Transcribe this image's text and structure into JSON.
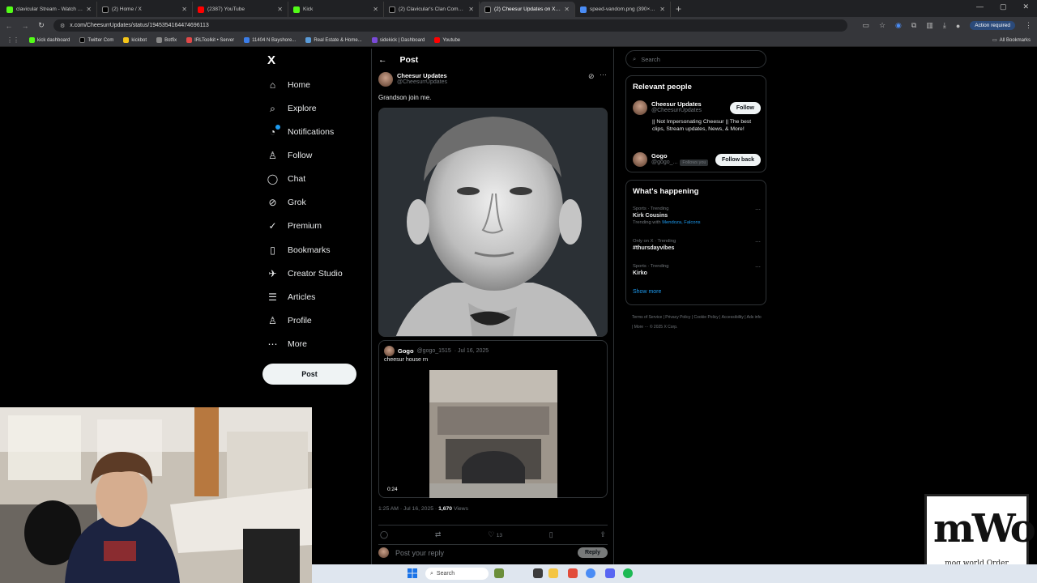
{
  "browser": {
    "tabs": [
      {
        "title": "clavicular Stream - Watch Live o",
        "color": "#53fc18"
      },
      {
        "title": "(2) Home / X",
        "color": "#000000"
      },
      {
        "title": "(2387) YouTube",
        "color": "#ff0000"
      },
      {
        "title": "Kick",
        "color": "#53fc18"
      },
      {
        "title": "(2) Clavicular's Clan Communit",
        "color": "#000000"
      },
      {
        "title": "(2) Cheesur Updates on X: \"Gra",
        "color": "#000000"
      },
      {
        "title": "speed-vandom.png (390×382)",
        "color": "#4a8cf5"
      }
    ],
    "url": "x.com/CheesurrUpdates/status/1945354164474696113",
    "action_required": "Action required",
    "bookmarks": [
      {
        "label": "kick dashboard",
        "color": "#53fc18"
      },
      {
        "label": "Twitter Com",
        "color": "#000000"
      },
      {
        "label": "kickbot",
        "color": "#f5c518"
      },
      {
        "label": "Botfix",
        "color": "#888888"
      },
      {
        "label": "IRLToolkit • Server",
        "color": "#e04848"
      },
      {
        "label": "11404 N Bayshore...",
        "color": "#3b7de8"
      },
      {
        "label": "Real Estate & Home...",
        "color": "#5a9bd8"
      },
      {
        "label": "sidekick | Dashboard",
        "color": "#7a4ad8"
      },
      {
        "label": "Youtube",
        "color": "#ff0000"
      }
    ],
    "all_bookmarks": "All Bookmarks"
  },
  "nav": {
    "logo": "X",
    "items": [
      {
        "label": "Home",
        "icon": "⌂"
      },
      {
        "label": "Explore",
        "icon": "⌕"
      },
      {
        "label": "Notifications",
        "icon": "🔔"
      },
      {
        "label": "Follow",
        "icon": "+"
      },
      {
        "label": "Chat",
        "icon": "◯"
      },
      {
        "label": "Grok",
        "icon": "⊘"
      },
      {
        "label": "Premium",
        "icon": "✓"
      },
      {
        "label": "Bookmarks",
        "icon": "▯"
      },
      {
        "label": "Creator Studio",
        "icon": "✈"
      },
      {
        "label": "Articles",
        "icon": "☰"
      },
      {
        "label": "Profile",
        "icon": "♙"
      },
      {
        "label": "More",
        "icon": "⋯"
      }
    ],
    "post_button": "Post"
  },
  "post": {
    "header": "Post",
    "author_name": "Cheesur Updates",
    "author_handle": "@CheesurrUpdates",
    "text": "Grandson join me.",
    "quote": {
      "author_name": "Gogo",
      "author_handle": "@gogo_1515",
      "date": "· Jul 16, 2025",
      "text": "cheesur house rn",
      "video_duration": "0:24"
    },
    "timestamp": "1:25 AM · Jul 16, 2025 ·",
    "views_count": "1,670",
    "views_label": "Views",
    "likes": "13",
    "reply_placeholder": "Post your reply",
    "reply_button": "Reply"
  },
  "sidebar": {
    "search_placeholder": "Search",
    "relevant_title": "Relevant people",
    "people": [
      {
        "name": "Cheesur Updates",
        "handle": "@CheesurrUpdates",
        "button": "Follow",
        "bio": "|| Not Impersonating Cheesur || The best clips, Stream updates, News, & More!"
      },
      {
        "name": "Gogo",
        "handle": "@gogo_...",
        "follows_you": "Follows you",
        "button": "Follow back"
      }
    ],
    "happening_title": "What's happening",
    "trends": [
      {
        "category": "Sports · Trending",
        "title": "Kirk Cousins",
        "with_prefix": "Trending with",
        "with": "Mendoza, Falcons"
      },
      {
        "category": "Only on X · Trending",
        "title": "#thursdayvibes"
      },
      {
        "category": "Sports · Trending",
        "title": "Kirko"
      }
    ],
    "show_more": "Show more",
    "footer": "Terms of Service  |  Privacy Policy  |  Cookie Policy  |  Accessibility  |  Ads info  |  More ···  © 2025 X Corp."
  },
  "overlay": {
    "watermark_logo": "mWo",
    "watermark_text": "mog world Order"
  },
  "taskbar": {
    "search": "Search"
  }
}
